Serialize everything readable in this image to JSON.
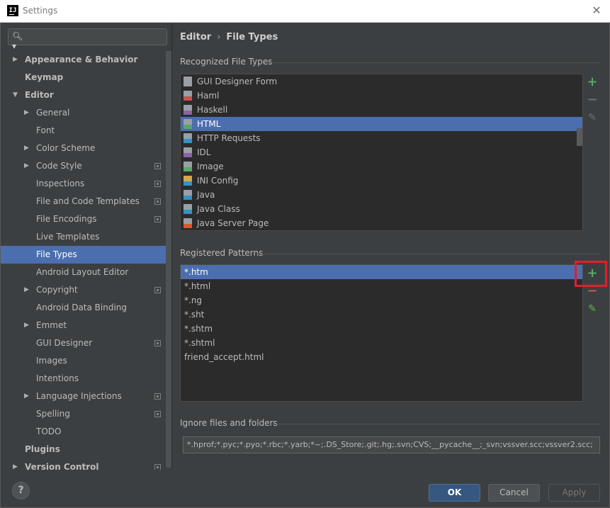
{
  "window": {
    "title": "Settings",
    "app_icon_text": "IJ"
  },
  "sidebar": {
    "search_placeholder": "",
    "items": [
      {
        "label": "Appearance & Behavior",
        "level": 0,
        "arrow": "right",
        "bold": true,
        "selected": false,
        "project_icon": false
      },
      {
        "label": "Keymap",
        "level": 0,
        "arrow": "",
        "bold": true,
        "selected": false,
        "project_icon": false
      },
      {
        "label": "Editor",
        "level": 0,
        "arrow": "down",
        "bold": true,
        "selected": false,
        "project_icon": false
      },
      {
        "label": "General",
        "level": 1,
        "arrow": "right",
        "bold": false,
        "selected": false,
        "project_icon": false
      },
      {
        "label": "Font",
        "level": 1,
        "arrow": "",
        "bold": false,
        "selected": false,
        "project_icon": false
      },
      {
        "label": "Color Scheme",
        "level": 1,
        "arrow": "right",
        "bold": false,
        "selected": false,
        "project_icon": false
      },
      {
        "label": "Code Style",
        "level": 1,
        "arrow": "right",
        "bold": false,
        "selected": false,
        "project_icon": true
      },
      {
        "label": "Inspections",
        "level": 1,
        "arrow": "",
        "bold": false,
        "selected": false,
        "project_icon": true
      },
      {
        "label": "File and Code Templates",
        "level": 1,
        "arrow": "",
        "bold": false,
        "selected": false,
        "project_icon": true
      },
      {
        "label": "File Encodings",
        "level": 1,
        "arrow": "",
        "bold": false,
        "selected": false,
        "project_icon": true
      },
      {
        "label": "Live Templates",
        "level": 1,
        "arrow": "",
        "bold": false,
        "selected": false,
        "project_icon": false
      },
      {
        "label": "File Types",
        "level": 1,
        "arrow": "",
        "bold": false,
        "selected": true,
        "project_icon": false
      },
      {
        "label": "Android Layout Editor",
        "level": 1,
        "arrow": "",
        "bold": false,
        "selected": false,
        "project_icon": false
      },
      {
        "label": "Copyright",
        "level": 1,
        "arrow": "right",
        "bold": false,
        "selected": false,
        "project_icon": true
      },
      {
        "label": "Android Data Binding",
        "level": 1,
        "arrow": "",
        "bold": false,
        "selected": false,
        "project_icon": false
      },
      {
        "label": "Emmet",
        "level": 1,
        "arrow": "right",
        "bold": false,
        "selected": false,
        "project_icon": false
      },
      {
        "label": "GUI Designer",
        "level": 1,
        "arrow": "",
        "bold": false,
        "selected": false,
        "project_icon": true
      },
      {
        "label": "Images",
        "level": 1,
        "arrow": "",
        "bold": false,
        "selected": false,
        "project_icon": false
      },
      {
        "label": "Intentions",
        "level": 1,
        "arrow": "",
        "bold": false,
        "selected": false,
        "project_icon": false
      },
      {
        "label": "Language Injections",
        "level": 1,
        "arrow": "right",
        "bold": false,
        "selected": false,
        "project_icon": true
      },
      {
        "label": "Spelling",
        "level": 1,
        "arrow": "",
        "bold": false,
        "selected": false,
        "project_icon": true
      },
      {
        "label": "TODO",
        "level": 1,
        "arrow": "",
        "bold": false,
        "selected": false,
        "project_icon": false
      },
      {
        "label": "Plugins",
        "level": 0,
        "arrow": "",
        "bold": true,
        "selected": false,
        "project_icon": false
      },
      {
        "label": "Version Control",
        "level": 0,
        "arrow": "right",
        "bold": true,
        "selected": false,
        "project_icon": true
      }
    ]
  },
  "breadcrumb": {
    "parent": "Editor",
    "separator": "›",
    "current": "File Types"
  },
  "recognized": {
    "label": "Recognized File Types",
    "items": [
      {
        "label": "GUI Designer Form",
        "icon": "form-icon",
        "color": "#9aa0a6",
        "tag_color": ""
      },
      {
        "label": "Haml",
        "icon": "haml-file-icon",
        "color": "#9aa0a6",
        "tag_color": "#c75450"
      },
      {
        "label": "Haskell",
        "icon": "haskell-file-icon",
        "color": "#9aa0a6",
        "tag_color": "#8a63a8"
      },
      {
        "label": "HTML",
        "icon": "html-file-icon",
        "color": "#9aa0a6",
        "tag_color": "#59a869"
      },
      {
        "label": "HTTP Requests",
        "icon": "http-file-icon",
        "color": "#9aa0a6",
        "tag_color": "#3592c4"
      },
      {
        "label": "IDL",
        "icon": "idl-file-icon",
        "color": "#9aa0a6",
        "tag_color": "#8a63a8"
      },
      {
        "label": "Image",
        "icon": "image-file-icon",
        "color": "#9aa0a6",
        "tag_color": "#59a869"
      },
      {
        "label": "INI Config",
        "icon": "ini-file-icon",
        "color": "#d6a84c",
        "tag_color": "#3592c4"
      },
      {
        "label": "Java",
        "icon": "java-file-icon",
        "color": "#9aa0a6",
        "tag_color": "#3592c4"
      },
      {
        "label": "Java Class",
        "icon": "java-class-icon",
        "color": "#9aa0a6",
        "tag_color": "#3592c4"
      },
      {
        "label": "Java Server Page",
        "icon": "jsp-file-icon",
        "color": "#9aa0a6",
        "tag_color": "#d65a2b"
      }
    ],
    "selected_index": 3
  },
  "patterns": {
    "label": "Registered Patterns",
    "items": [
      "*.htm",
      "*.html",
      "*.ng",
      "*.sht",
      "*.shtm",
      "*.shtml",
      "friend_accept.html"
    ],
    "selected_index": 0
  },
  "toolbar": {
    "add": "+",
    "remove": "−",
    "edit": "✎"
  },
  "ignore": {
    "label": "Ignore files and folders",
    "value": "*.hprof;*.pyc;*.pyo;*.rbc;*.yarb;*~;.DS_Store;.git;.hg;.svn;CVS;__pycache__;_svn;vssver.scc;vssver2.scc;"
  },
  "buttons": {
    "help": "?",
    "ok": "OK",
    "cancel": "Cancel",
    "apply": "Apply"
  },
  "colors": {
    "accent": "#4b6eaf",
    "add_green": "#59a869",
    "remove_red": "#c75450",
    "highlight_box": "#e0202a"
  }
}
